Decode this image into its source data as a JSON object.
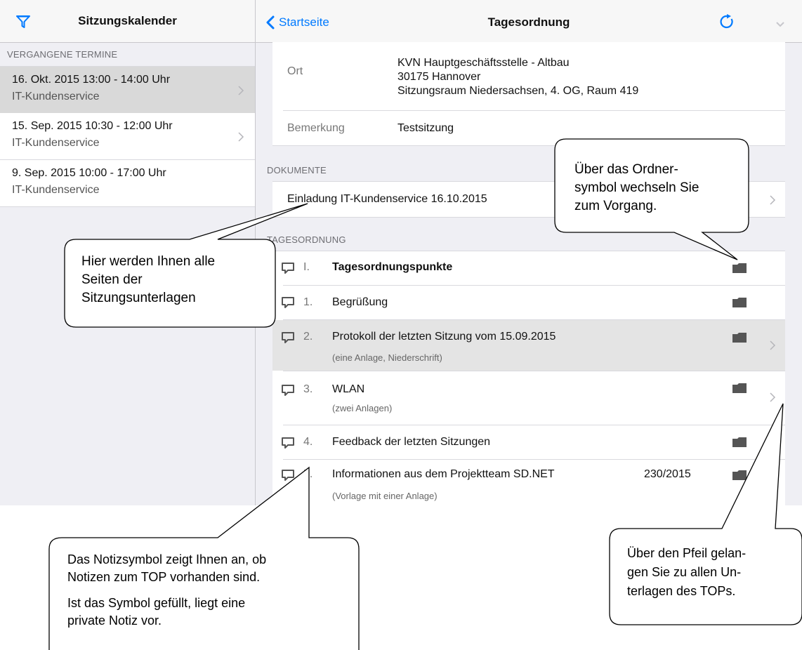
{
  "sidebar": {
    "title": "Sitzungskalender",
    "section_label": "VERGANGENE TERMINE",
    "items": [
      {
        "line1": "16. Okt. 2015 13:00 - 14:00 Uhr",
        "line2": "IT-Kundenservice"
      },
      {
        "line1": "15. Sep. 2015 10:30 - 12:00 Uhr",
        "line2": "IT-Kundenservice"
      },
      {
        "line1": "9. Sep. 2015 10:00 - 17:00 Uhr",
        "line2": "IT-Kundenservice"
      }
    ]
  },
  "header": {
    "back_label": "Startseite",
    "title": "Tagesordnung"
  },
  "details": {
    "ort_label": "Ort",
    "ort_lines": [
      "KVN Hauptgeschäftsstelle - Altbau",
      "30175 Hannover",
      "Sitzungsraum Niedersachsen, 4. OG, Raum 419"
    ],
    "bemerkung_label": "Bemerkung",
    "bemerkung_value": "Testsitzung"
  },
  "documents": {
    "section_label": "DOKUMENTE",
    "items": [
      {
        "label": "Einladung IT-Kundenservice 16.10.2015"
      }
    ]
  },
  "agenda": {
    "section_label": "TAGESORDNUNG",
    "items": [
      {
        "num": "I.",
        "title": "Tagesordnungspunkte",
        "sub": "",
        "ref": ""
      },
      {
        "num": "1.",
        "title": "Begrüßung",
        "sub": "",
        "ref": ""
      },
      {
        "num": "2.",
        "title": "Protokoll der letzten Sitzung vom 15.09.2015",
        "sub": "(eine Anlage, Niederschrift)",
        "ref": ""
      },
      {
        "num": "3.",
        "title": "WLAN",
        "sub": "(zwei Anlagen)",
        "ref": ""
      },
      {
        "num": "4.",
        "title": "Feedback der letzten Sitzungen",
        "sub": "",
        "ref": ""
      },
      {
        "num": "5.",
        "title": "Informationen aus  dem Projektteam SD.NET",
        "sub": "(Vorlage mit einer Anlage)",
        "ref": "230/2015"
      }
    ]
  },
  "callouts": {
    "folder": [
      "Über das Ordner-",
      "symbol wechseln Sie",
      "zum Vorgang."
    ],
    "pages": [
      "Hier werden Ihnen alle",
      "Seiten der",
      "Sitzungsunterlagen"
    ],
    "note_a": [
      "Das Notizsymbol zeigt Ihnen an, ob",
      "Notizen zum TOP vorhanden sind."
    ],
    "note_b": [
      "Ist das Symbol gefüllt, liegt eine",
      "private Notiz vor."
    ],
    "arrow": [
      "Über den Pfeil gelan-",
      "gen Sie zu allen Un-",
      "terlagen des TOPs."
    ]
  },
  "colors": {
    "accent": "#007aff",
    "selected_row": "#d9d9d9",
    "background": "#efeff4"
  },
  "icons": [
    "filter-icon",
    "back-chevron-icon",
    "refresh-icon",
    "chevron-down-icon",
    "note-icon",
    "folder-icon",
    "chevron-right-icon"
  ]
}
